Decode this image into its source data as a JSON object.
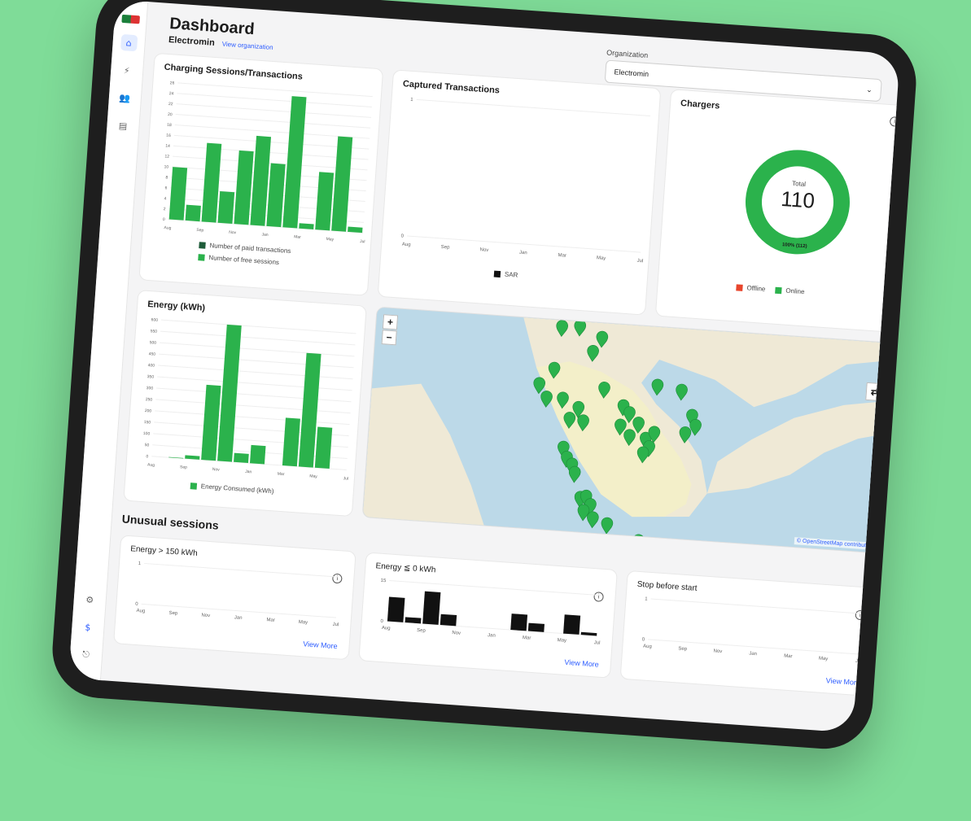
{
  "header": {
    "title": "Dashboard",
    "org_name": "Electromin",
    "org_link": "View organization"
  },
  "org_selector": {
    "label": "Organization",
    "value": "Electromin"
  },
  "sidebar": {
    "icons": [
      "home-icon",
      "charger-icon",
      "users-icon",
      "document-icon"
    ],
    "bottom_icons": [
      "settings-icon",
      "dollar-icon",
      "logout-icon"
    ]
  },
  "sessions_chart": {
    "title": "Charging Sessions/Transactions",
    "legend_paid": "Number of paid transactions",
    "legend_free": "Number of free sessions"
  },
  "captured_chart": {
    "title": "Captured Transactions",
    "legend": "SAR"
  },
  "chargers": {
    "title": "Chargers",
    "total_label": "Total",
    "total": "110",
    "ring_label": "100% (112)",
    "legend_offline": "Offline",
    "legend_online": "Online"
  },
  "energy_chart": {
    "title": "Energy (kWh)",
    "legend": "Energy Consumed (kWh)"
  },
  "map": {
    "zoom_in": "+",
    "zoom_out": "−",
    "attribution": "© OpenStreetMap contributors"
  },
  "unusual": {
    "title": "Unusual sessions",
    "card1_title": "Energy > 150 kWh",
    "card2_title": "Energy ≦ 0 kWh",
    "card3_title": "Stop before start",
    "view_more": "View More"
  },
  "colors": {
    "green": "#2bb24c",
    "dark_green": "#1e5c3a",
    "offline": "#e8452c",
    "link": "#2c5cff"
  },
  "chart_data": [
    {
      "type": "bar",
      "title": "Charging Sessions/Transactions",
      "categories": [
        "Aug",
        "Sep",
        "Oct",
        "Nov",
        "Dec",
        "Jan",
        "Feb",
        "Mar",
        "Apr",
        "May",
        "Jun",
        "Jul"
      ],
      "tick_labels": [
        "Aug",
        "Sep",
        "Nov",
        "Jan",
        "Mar",
        "May",
        "Jul"
      ],
      "yticks": [
        "0",
        "2",
        "4",
        "6",
        "8",
        "10",
        "12",
        "14",
        "16",
        "18",
        "20",
        "22",
        "24",
        "26"
      ],
      "ylim": [
        0,
        26
      ],
      "series": [
        {
          "name": "Number of paid transactions",
          "values": [
            0,
            0,
            0,
            0,
            0,
            0,
            0,
            0,
            0,
            0,
            0,
            0
          ]
        },
        {
          "name": "Number of free sessions",
          "values": [
            10,
            3,
            15,
            6,
            14,
            17,
            12,
            25,
            1,
            11,
            18,
            1
          ]
        }
      ]
    },
    {
      "type": "bar",
      "title": "Captured Transactions",
      "categories": [
        "Aug",
        "Sep",
        "Nov",
        "Jan",
        "Mar",
        "May",
        "Jul"
      ],
      "yticks": [
        "0",
        "1"
      ],
      "ylim": [
        0,
        1
      ],
      "series": [
        {
          "name": "SAR",
          "values": [
            0,
            0,
            0,
            0,
            0,
            0,
            0
          ]
        }
      ]
    },
    {
      "type": "pie",
      "title": "Chargers",
      "categories": [
        "Offline",
        "Online"
      ],
      "values": [
        0,
        112
      ]
    },
    {
      "type": "bar",
      "title": "Energy (kWh)",
      "categories": [
        "Aug",
        "Sep",
        "Oct",
        "Nov",
        "Dec",
        "Jan",
        "Feb",
        "Mar",
        "Apr",
        "May",
        "Jun",
        "Jul"
      ],
      "tick_labels": [
        "Aug",
        "Sep",
        "Nov",
        "Jan",
        "Mar",
        "May",
        "Jul"
      ],
      "yticks": [
        "0",
        "50",
        "100",
        "150",
        "200",
        "250",
        "300",
        "350",
        "400",
        "450",
        "500",
        "550",
        "600"
      ],
      "ylim": [
        0,
        600
      ],
      "series": [
        {
          "name": "Energy Consumed (kWh)",
          "values": [
            0,
            2,
            15,
            330,
            610,
            40,
            80,
            0,
            210,
            500,
            180,
            0
          ]
        }
      ]
    },
    {
      "type": "bar",
      "title": "Energy > 150 kWh",
      "categories": [
        "Aug",
        "Sep",
        "Nov",
        "Jan",
        "Mar",
        "May",
        "Jul"
      ],
      "yticks": [
        "0",
        "1"
      ],
      "ylim": [
        0,
        1
      ],
      "values": [
        0,
        0,
        0,
        0,
        0,
        0,
        0
      ]
    },
    {
      "type": "bar",
      "title": "Energy ≦ 0 kWh",
      "categories": [
        "Aug",
        "Sep",
        "Oct",
        "Nov",
        "Dec",
        "Jan",
        "Feb",
        "Mar",
        "Apr",
        "May",
        "Jun",
        "Jul"
      ],
      "tick_labels": [
        "Aug",
        "Sep",
        "Nov",
        "Jan",
        "Mar",
        "May",
        "Jul"
      ],
      "yticks": [
        "0",
        "15"
      ],
      "ylim": [
        0,
        15
      ],
      "values": [
        9,
        2,
        12,
        4,
        0,
        0,
        0,
        6,
        3,
        0,
        7,
        1
      ]
    },
    {
      "type": "bar",
      "title": "Stop before start",
      "categories": [
        "Aug",
        "Sep",
        "Nov",
        "Jan",
        "Mar",
        "May",
        "Jul"
      ],
      "yticks": [
        "0",
        "1"
      ],
      "ylim": [
        0,
        1
      ],
      "values": [
        0,
        0,
        0,
        0,
        0,
        0,
        0
      ]
    }
  ]
}
